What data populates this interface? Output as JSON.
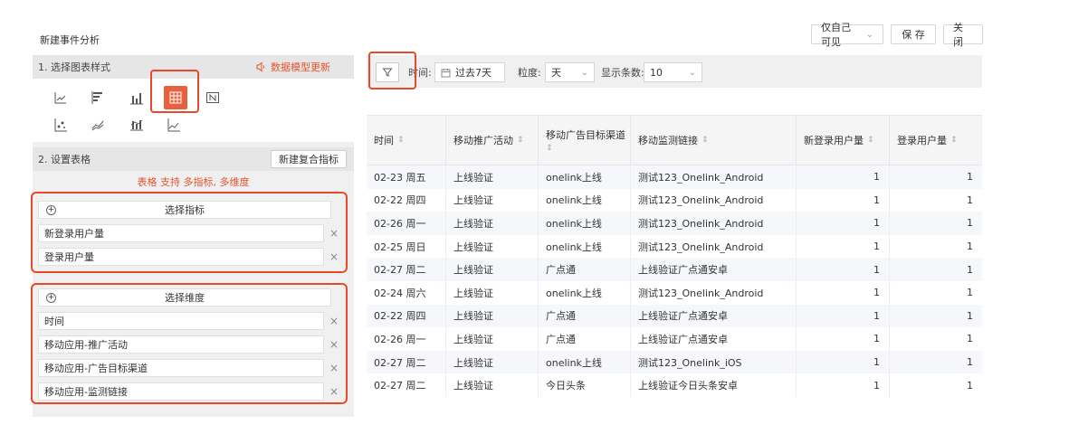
{
  "page": {
    "title": "新建事件分析"
  },
  "header": {
    "visibility_label": "仅自己可见",
    "save_label": "保 存",
    "close_label": "关 闭"
  },
  "step1": {
    "title": "1. 选择图表样式",
    "update_label": "数据模型更新",
    "chart_types": [
      "line-chart-icon",
      "horizontal-bar-icon",
      "bar-chart-icon",
      "table-icon",
      "number-icon",
      "scatter-icon",
      "area-icon",
      "stacked-bar-icon",
      "dual-axis-icon"
    ],
    "selected": "table-icon"
  },
  "step2": {
    "title": "2. 设置表格",
    "compound_metric_button": "新建复合指标",
    "hint": "表格 支持 多指标, 多维度",
    "metrics": {
      "select_label": "选择指标",
      "items": [
        "新登录用户量",
        "登录用户量"
      ]
    },
    "dimensions": {
      "select_label": "选择维度",
      "items": [
        "时间",
        "移动应用-推广活动",
        "移动应用-广告目标渠道",
        "移动应用-监测链接"
      ]
    }
  },
  "filters": {
    "time_label": "时间:",
    "time_value": "过去7天",
    "granularity_label": "粒度:",
    "granularity_value": "天",
    "rows_label": "显示条数:",
    "rows_value": "10"
  },
  "table": {
    "headers": [
      "时间",
      "移动推广活动",
      "移动广告目标渠道",
      "移动监测链接",
      "新登录用户量",
      "登录用户量"
    ],
    "rows": [
      [
        "02-23 周五",
        "上线验证",
        "onelink上线",
        "测试123_Onelink_Android",
        "1",
        "1"
      ],
      [
        "02-22 周四",
        "上线验证",
        "onelink上线",
        "测试123_Onelink_Android",
        "1",
        "1"
      ],
      [
        "02-26 周一",
        "上线验证",
        "onelink上线",
        "测试123_Onelink_Android",
        "1",
        "1"
      ],
      [
        "02-25 周日",
        "上线验证",
        "onelink上线",
        "测试123_Onelink_Android",
        "1",
        "1"
      ],
      [
        "02-27 周二",
        "上线验证",
        "广点通",
        "上线验证广点通安卓",
        "1",
        "1"
      ],
      [
        "02-24 周六",
        "上线验证",
        "onelink上线",
        "测试123_Onelink_Android",
        "1",
        "1"
      ],
      [
        "02-22 周四",
        "上线验证",
        "广点通",
        "上线验证广点通安卓",
        "1",
        "1"
      ],
      [
        "02-26 周一",
        "上线验证",
        "广点通",
        "上线验证广点通安卓",
        "1",
        "1"
      ],
      [
        "02-27 周二",
        "上线验证",
        "onelink上线",
        "测试123_Onelink_iOS",
        "1",
        "1"
      ],
      [
        "02-27 周二",
        "上线验证",
        "今日头条",
        "上线验证今日头条安卓",
        "1",
        "1"
      ]
    ]
  },
  "colors": {
    "accent": "#e8603c",
    "highlight_border": "#e84a27"
  }
}
